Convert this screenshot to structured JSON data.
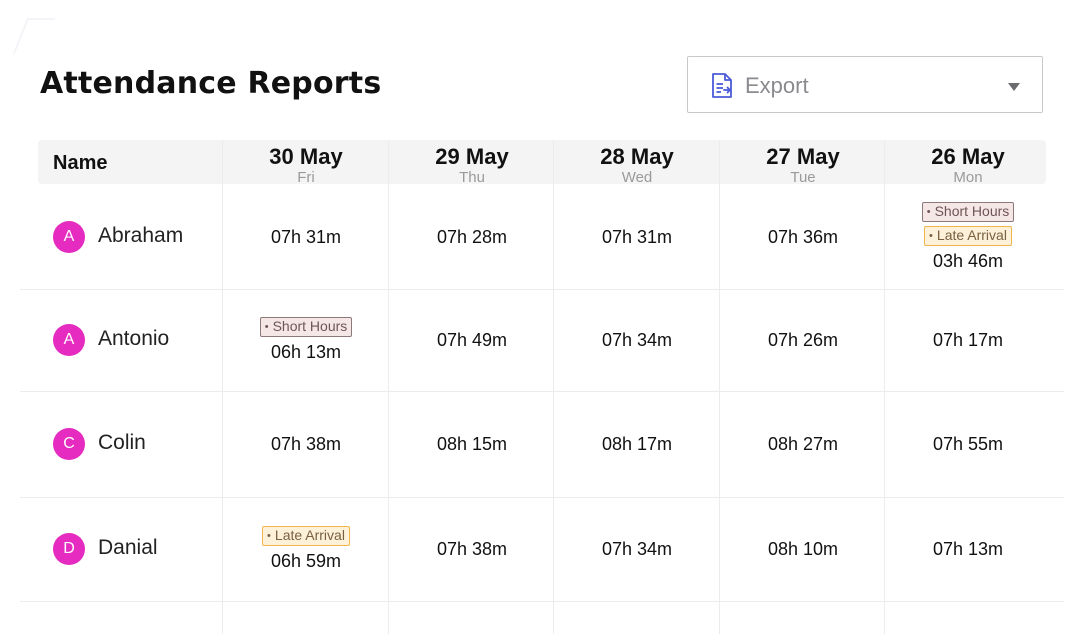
{
  "page": {
    "title": "Attendance Reports"
  },
  "export": {
    "label": "Export"
  },
  "table": {
    "name_header": "Name",
    "columns": [
      {
        "date": "30 May",
        "dow": "Fri"
      },
      {
        "date": "29 May",
        "dow": "Thu"
      },
      {
        "date": "28 May",
        "dow": "Wed"
      },
      {
        "date": "27 May",
        "dow": "Tue"
      },
      {
        "date": "26 May",
        "dow": "Mon"
      }
    ],
    "rows": [
      {
        "initial": "A",
        "name": "Abraham",
        "cells": [
          {
            "hours": "07h 31m",
            "tags": []
          },
          {
            "hours": "07h 28m",
            "tags": []
          },
          {
            "hours": "07h 31m",
            "tags": []
          },
          {
            "hours": "07h 36m",
            "tags": []
          },
          {
            "hours": "03h 46m",
            "tags": [
              "Short Hours",
              "Late Arrival"
            ]
          }
        ]
      },
      {
        "initial": "A",
        "name": "Antonio",
        "cells": [
          {
            "hours": "06h 13m",
            "tags": [
              "Short Hours"
            ]
          },
          {
            "hours": "07h 49m",
            "tags": []
          },
          {
            "hours": "07h 34m",
            "tags": []
          },
          {
            "hours": "07h 26m",
            "tags": []
          },
          {
            "hours": "07h 17m",
            "tags": []
          }
        ]
      },
      {
        "initial": "C",
        "name": "Colin",
        "cells": [
          {
            "hours": "07h 38m",
            "tags": []
          },
          {
            "hours": "08h 15m",
            "tags": []
          },
          {
            "hours": "08h 17m",
            "tags": []
          },
          {
            "hours": "08h 27m",
            "tags": []
          },
          {
            "hours": "07h 55m",
            "tags": []
          }
        ]
      },
      {
        "initial": "D",
        "name": "Danial",
        "cells": [
          {
            "hours": "06h 59m",
            "tags": [
              "Late Arrival"
            ]
          },
          {
            "hours": "07h 38m",
            "tags": []
          },
          {
            "hours": "07h 34m",
            "tags": []
          },
          {
            "hours": "08h 10m",
            "tags": []
          },
          {
            "hours": "07h 13m",
            "tags": []
          }
        ]
      }
    ]
  },
  "icons": {
    "export": "document-export-icon",
    "dropdown": "chevron-down-icon"
  },
  "colors": {
    "avatar": "#e52bc0",
    "export_icon": "#4b5bd8",
    "short_hours_bg": "#f6e7e7",
    "late_arrival_bg": "#fdf1d9",
    "late_arrival_border": "#f2b54c"
  }
}
